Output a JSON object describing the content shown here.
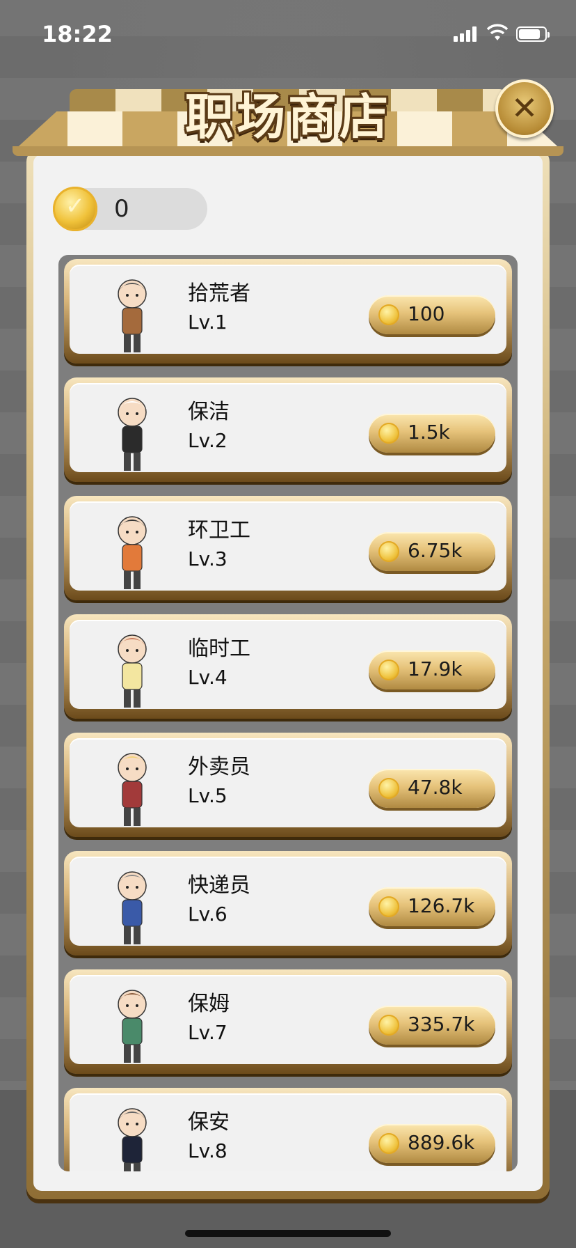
{
  "status": {
    "time": "18:22"
  },
  "shop": {
    "title": "职场商店",
    "close_label": "✕"
  },
  "wallet": {
    "coins": "0"
  },
  "items": [
    {
      "name": "拾荒者",
      "level": "Lv.1",
      "price": "100",
      "color": "#a46a3c",
      "accent": "#555"
    },
    {
      "name": "保洁",
      "level": "Lv.2",
      "price": "1.5k",
      "color": "#2b2b2b",
      "accent": "#ffffff"
    },
    {
      "name": "环卫工",
      "level": "Lv.3",
      "price": "6.75k",
      "color": "#e27a3a",
      "accent": "#333"
    },
    {
      "name": "临时工",
      "level": "Lv.4",
      "price": "17.9k",
      "color": "#f3e6a0",
      "accent": "#c87a5a"
    },
    {
      "name": "外卖员",
      "level": "Lv.5",
      "price": "47.8k",
      "color": "#a23a3a",
      "accent": "#f2d27a"
    },
    {
      "name": "快递员",
      "level": "Lv.6",
      "price": "126.7k",
      "color": "#3a5aa8",
      "accent": "#888"
    },
    {
      "name": "保姆",
      "level": "Lv.7",
      "price": "335.7k",
      "color": "#4a8a6a",
      "accent": "#8a5a3a"
    },
    {
      "name": "保安",
      "level": "Lv.8",
      "price": "889.6k",
      "color": "#1e2438",
      "accent": "#666"
    }
  ]
}
